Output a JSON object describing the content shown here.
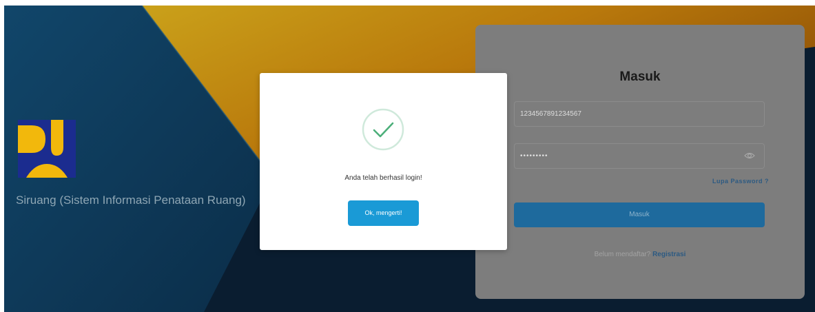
{
  "branding": {
    "app_title": "Siruang (Sistem Informasi Penataan Ruang)",
    "logo_icon": "pupr-logo-icon"
  },
  "login_form": {
    "title": "Masuk",
    "username_value": "1234567891234567",
    "password_value": "•••••••••",
    "password_toggle_icon": "eye-icon",
    "forgot_password_label": "Lupa Password ?",
    "submit_label": "Masuk",
    "register_prompt": "Belum mendaftar?",
    "register_link": "Registrasi"
  },
  "success_modal": {
    "icon": "check-circle-icon",
    "message": "Anda telah berhasil login!",
    "confirm_label": "Ok, mengerti!"
  },
  "colors": {
    "accent_blue": "#1a9ad6",
    "success_green": "#4caf7a",
    "background_navy": "#0f2a44",
    "background_gold": "#c08a10"
  }
}
